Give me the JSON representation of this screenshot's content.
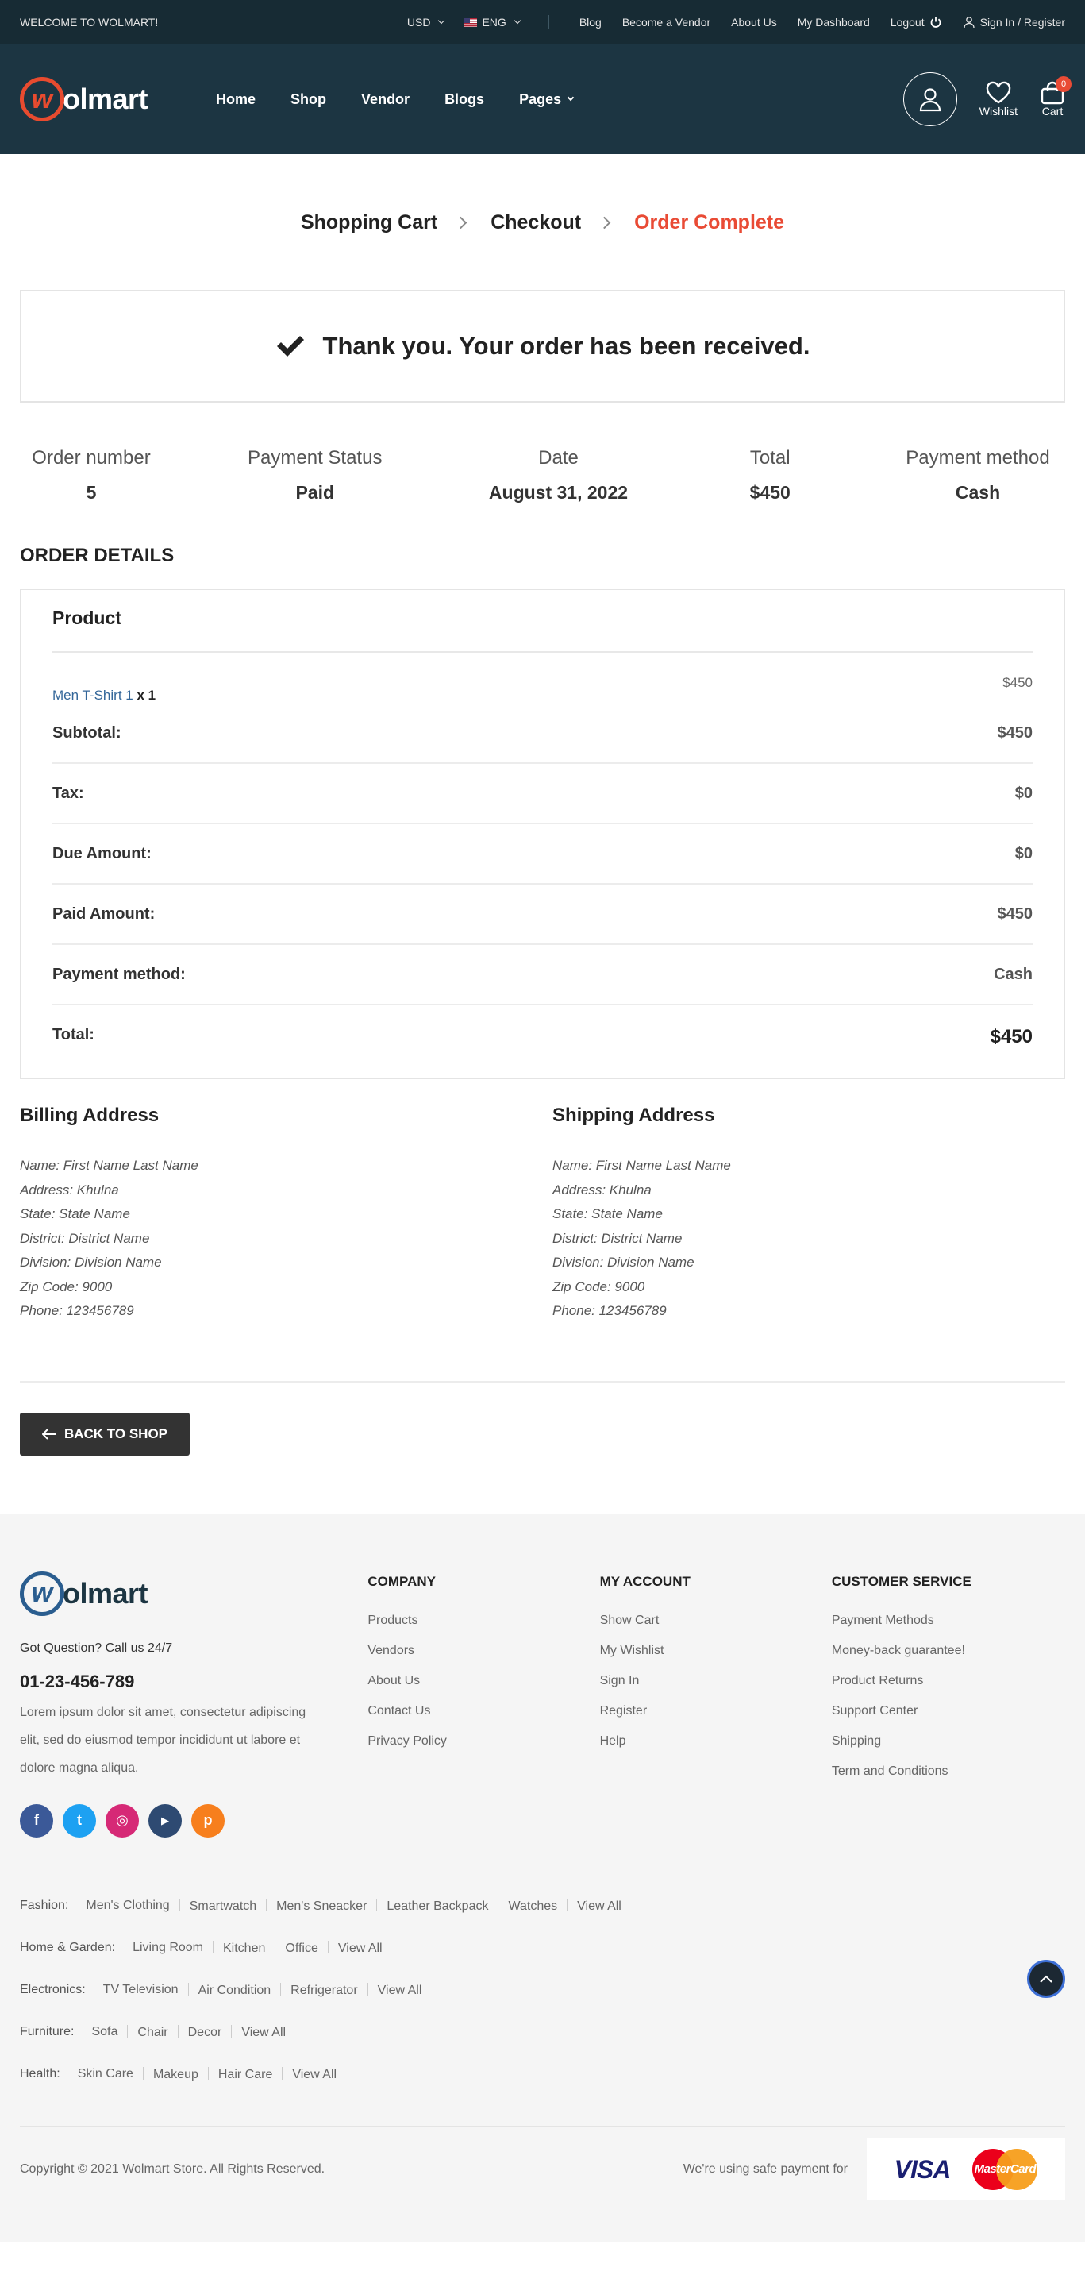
{
  "topbar": {
    "welcome": "WELCOME TO WOLMART!",
    "currency": "USD",
    "language": "ENG",
    "links": [
      "Blog",
      "Become a Vendor",
      "About Us",
      "My Dashboard",
      "Logout"
    ],
    "signin": "Sign In / Register"
  },
  "header": {
    "logo_mark": "w",
    "logo_text": "olmart",
    "nav": [
      "Home",
      "Shop",
      "Vendor",
      "Blogs",
      "Pages"
    ],
    "wishlist": "Wishlist",
    "cart": "Cart",
    "cart_count": "0"
  },
  "steps": [
    "Shopping Cart",
    "Checkout",
    "Order Complete"
  ],
  "thanks": "Thank you. Your order has been received.",
  "summary": [
    {
      "label": "Order number",
      "value": "5"
    },
    {
      "label": "Payment Status",
      "value": "Paid"
    },
    {
      "label": "Date",
      "value": "August 31, 2022"
    },
    {
      "label": "Total",
      "value": "$450"
    },
    {
      "label": "Payment method",
      "value": "Cash"
    }
  ],
  "order_details": {
    "title": "ORDER DETAILS",
    "product_header": "Product",
    "item": {
      "name": "Men T-Shirt 1",
      "qty": "x 1",
      "price": "$450"
    },
    "rows": [
      {
        "label": "Subtotal:",
        "value": "$450"
      },
      {
        "label": "Tax:",
        "value": "$0"
      },
      {
        "label": "Due Amount:",
        "value": "$0"
      },
      {
        "label": "Paid Amount:",
        "value": "$450"
      },
      {
        "label": "Payment method:",
        "value": "Cash"
      },
      {
        "label": "Total:",
        "value": "$450"
      }
    ]
  },
  "billing": {
    "title": "Billing Address",
    "lines": [
      "Name: First Name Last Name",
      "Address: Khulna",
      "State: State Name",
      "District: District Name",
      "Division: Division Name",
      "Zip Code: 9000",
      "Phone: 123456789"
    ]
  },
  "shipping": {
    "title": "Shipping Address",
    "lines": [
      "Name: First Name Last Name",
      "Address: Khulna",
      "State: State Name",
      "District: District Name",
      "Division: Division Name",
      "Zip Code: 9000",
      "Phone: 123456789"
    ]
  },
  "back_button": "BACK TO SHOP",
  "footer": {
    "question": "Got Question? Call us 24/7",
    "phone": "01-23-456-789",
    "description": "Lorem ipsum dolor sit amet, consectetur adipiscing elit, sed do eiusmod tempor incididunt ut labore et dolore magna aliqua.",
    "social": [
      {
        "icon": "facebook-icon",
        "glyph": "f",
        "color": "#3b5998"
      },
      {
        "icon": "twitter-icon",
        "glyph": "t",
        "color": "#1da1f2"
      },
      {
        "icon": "instagram-icon",
        "glyph": "◎",
        "color": "#d62976"
      },
      {
        "icon": "youtube-icon",
        "glyph": "▶",
        "color": "#2e4a72"
      },
      {
        "icon": "pinterest-icon",
        "glyph": "p",
        "color": "#f77f1d"
      }
    ],
    "columns": [
      {
        "title": "COMPANY",
        "items": [
          "Products",
          "Vendors",
          "About Us",
          "Contact Us",
          "Privacy Policy"
        ]
      },
      {
        "title": "MY ACCOUNT",
        "items": [
          "Show Cart",
          "My Wishlist",
          "Sign In",
          "Register",
          "Help"
        ]
      },
      {
        "title": "CUSTOMER SERVICE",
        "items": [
          "Payment Methods",
          "Money-back guarantee!",
          "Product Returns",
          "Support Center",
          "Shipping",
          "Term and Conditions"
        ]
      }
    ],
    "categories": [
      {
        "label": "Fashion:",
        "items": [
          "Men's Clothing",
          "Smartwatch",
          "Men's Sneacker",
          "Leather Backpack",
          "Watches",
          "View All"
        ]
      },
      {
        "label": "Home & Garden:",
        "items": [
          "Living Room",
          "Kitchen",
          "Office",
          "View All"
        ]
      },
      {
        "label": "Electronics:",
        "items": [
          "TV Television",
          "Air Condition",
          "Refrigerator",
          "View All"
        ]
      },
      {
        "label": "Furniture:",
        "items": [
          "Sofa",
          "Chair",
          "Decor",
          "View All"
        ]
      },
      {
        "label": "Health:",
        "items": [
          "Skin Care",
          "Makeup",
          "Hair Care",
          "View All"
        ]
      }
    ],
    "copyright": "Copyright © 2021 Wolmart Store. All Rights Reserved.",
    "safe_payment": "We're using safe payment for",
    "visa": "VISA",
    "mastercard": "MasterCard"
  },
  "colors": {
    "accent": "#e94b35",
    "header": "#1c3542",
    "topbar": "#172b34"
  }
}
